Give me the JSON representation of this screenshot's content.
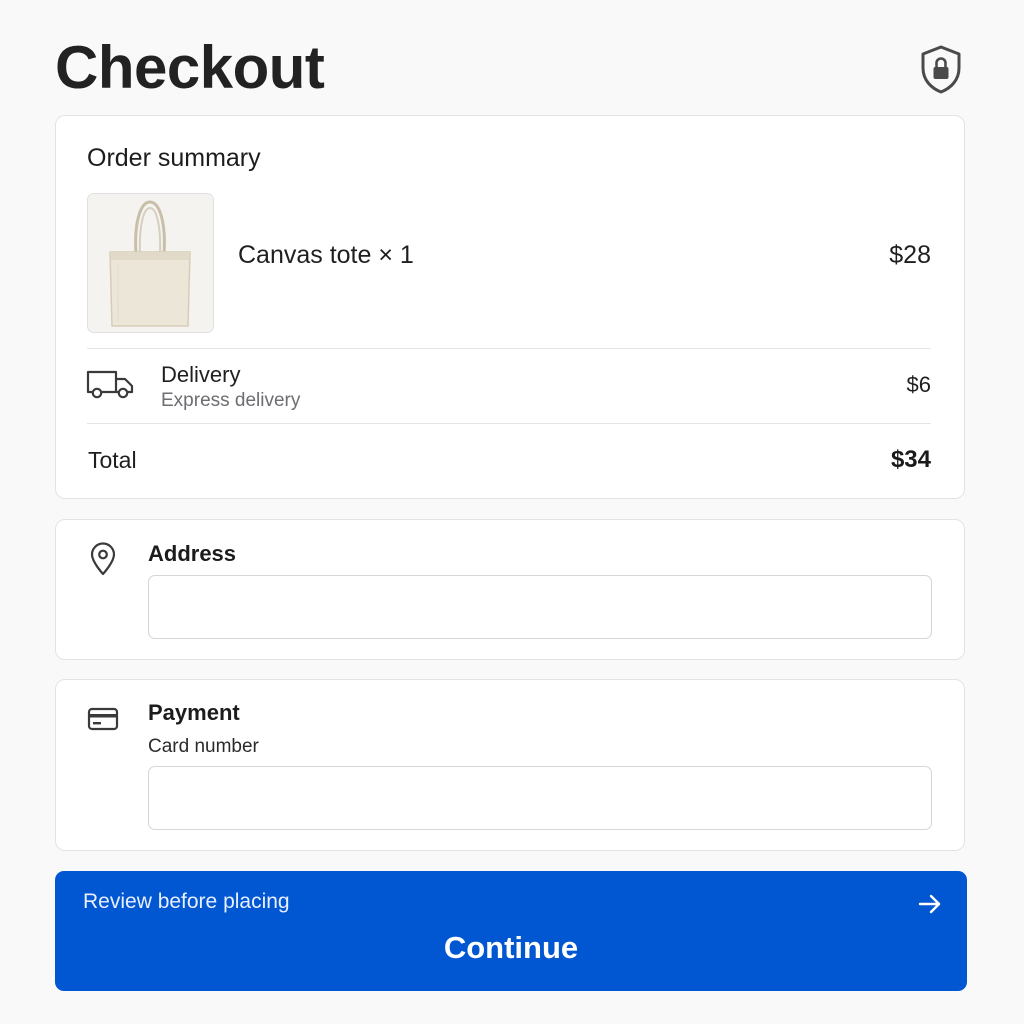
{
  "header": {
    "title": "Checkout",
    "lock_icon": "lock-shield-icon"
  },
  "summary": {
    "title": "Order summary",
    "item": {
      "name": "Canvas tote × 1",
      "price": "$28",
      "image": "canvas-tote-thumbnail"
    },
    "delivery": {
      "icon": "truck-icon",
      "label": "Delivery",
      "sublabel": "Express delivery",
      "price": "$6"
    },
    "total": {
      "label": "Total",
      "price": "$34"
    }
  },
  "address": {
    "icon": "map-pin-icon",
    "title": "Address",
    "value": "",
    "placeholder": ""
  },
  "payment": {
    "icon": "credit-card-icon",
    "title": "Payment",
    "card_label": "Card number",
    "value": "",
    "placeholder": ""
  },
  "cta": {
    "hint": "Review before placing",
    "label": "Continue",
    "icon": "arrow-right-icon",
    "color": "#0156d1"
  }
}
